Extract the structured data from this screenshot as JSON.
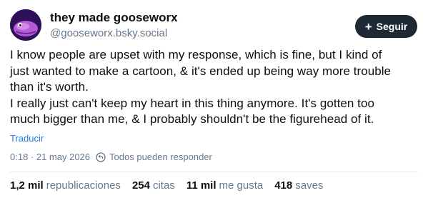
{
  "author": {
    "display_name": "they made gooseworx",
    "handle": "@gooseworx.bsky.social"
  },
  "follow": {
    "icon": "plus-icon",
    "plus": "+",
    "label": "Seguir"
  },
  "post": {
    "lines": [
      "I know people are upset with my response, which is fine, but I kind of",
      "just wanted to make a cartoon, & it's ended up being way more trouble",
      "than it's worth.",
      "I really just can't keep my heart in this thing anymore. It's gotten too",
      "much bigger than me, & I probably shouldn't be the figurehead of it."
    ],
    "translate": "Traducir",
    "timestamp": "0:18 · 21 may 2026",
    "reply_setting": "Todos pueden responder",
    "reply_icon": "reply-permission-icon"
  },
  "stats": {
    "reposts_count": "1,2 mil",
    "reposts_label": "republicaciones",
    "quotes_count": "254",
    "quotes_label": "citas",
    "likes_count": "11 mil",
    "likes_label": "me gusta",
    "saves_count": "418",
    "saves_label": "saves"
  },
  "colors": {
    "follow_button_bg": "#1e2936",
    "link": "#1f7ae6",
    "muted": "#66788a",
    "avatar_bg": "#2d0f5a",
    "avatar_creature": "#b45ad6"
  }
}
